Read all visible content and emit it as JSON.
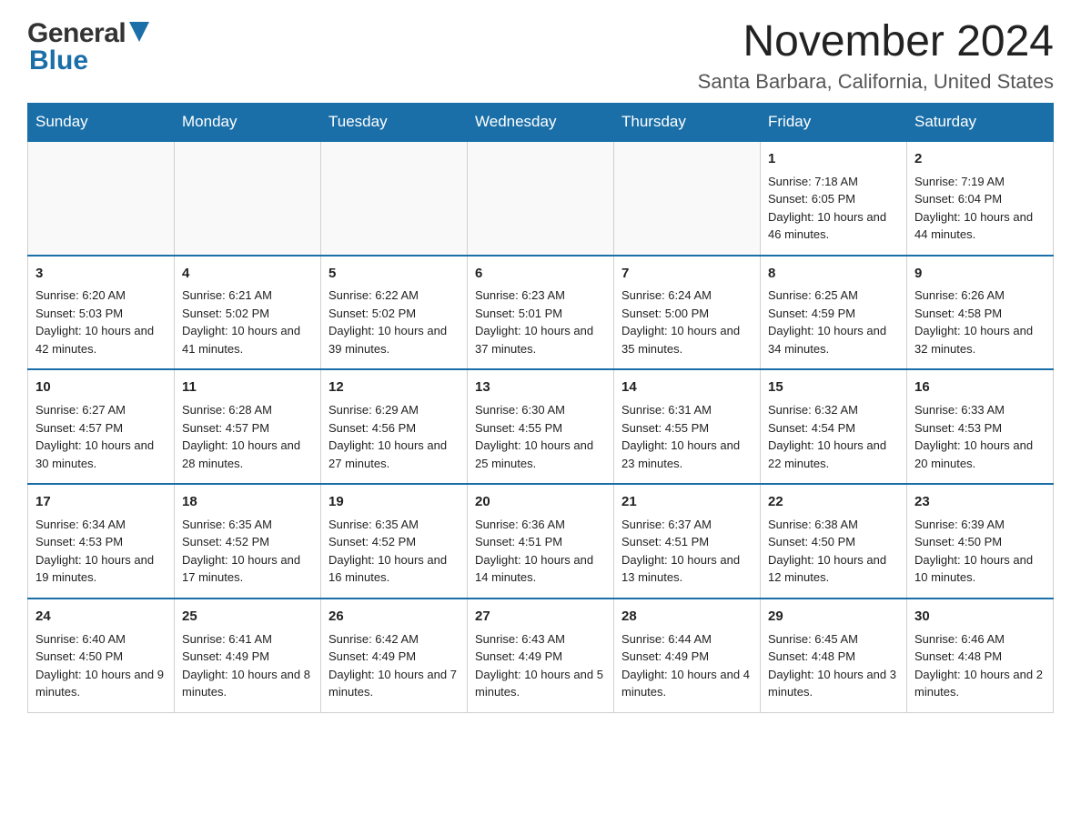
{
  "logo": {
    "general": "General",
    "blue": "Blue",
    "arrow_color": "#1a6fa8"
  },
  "title": "November 2024",
  "subtitle": "Santa Barbara, California, United States",
  "header_color": "#1a6fa8",
  "days_of_week": [
    "Sunday",
    "Monday",
    "Tuesday",
    "Wednesday",
    "Thursday",
    "Friday",
    "Saturday"
  ],
  "weeks": [
    [
      {
        "day": "",
        "info": ""
      },
      {
        "day": "",
        "info": ""
      },
      {
        "day": "",
        "info": ""
      },
      {
        "day": "",
        "info": ""
      },
      {
        "day": "",
        "info": ""
      },
      {
        "day": "1",
        "info": "Sunrise: 7:18 AM\nSunset: 6:05 PM\nDaylight: 10 hours and 46 minutes."
      },
      {
        "day": "2",
        "info": "Sunrise: 7:19 AM\nSunset: 6:04 PM\nDaylight: 10 hours and 44 minutes."
      }
    ],
    [
      {
        "day": "3",
        "info": "Sunrise: 6:20 AM\nSunset: 5:03 PM\nDaylight: 10 hours and 42 minutes."
      },
      {
        "day": "4",
        "info": "Sunrise: 6:21 AM\nSunset: 5:02 PM\nDaylight: 10 hours and 41 minutes."
      },
      {
        "day": "5",
        "info": "Sunrise: 6:22 AM\nSunset: 5:02 PM\nDaylight: 10 hours and 39 minutes."
      },
      {
        "day": "6",
        "info": "Sunrise: 6:23 AM\nSunset: 5:01 PM\nDaylight: 10 hours and 37 minutes."
      },
      {
        "day": "7",
        "info": "Sunrise: 6:24 AM\nSunset: 5:00 PM\nDaylight: 10 hours and 35 minutes."
      },
      {
        "day": "8",
        "info": "Sunrise: 6:25 AM\nSunset: 4:59 PM\nDaylight: 10 hours and 34 minutes."
      },
      {
        "day": "9",
        "info": "Sunrise: 6:26 AM\nSunset: 4:58 PM\nDaylight: 10 hours and 32 minutes."
      }
    ],
    [
      {
        "day": "10",
        "info": "Sunrise: 6:27 AM\nSunset: 4:57 PM\nDaylight: 10 hours and 30 minutes."
      },
      {
        "day": "11",
        "info": "Sunrise: 6:28 AM\nSunset: 4:57 PM\nDaylight: 10 hours and 28 minutes."
      },
      {
        "day": "12",
        "info": "Sunrise: 6:29 AM\nSunset: 4:56 PM\nDaylight: 10 hours and 27 minutes."
      },
      {
        "day": "13",
        "info": "Sunrise: 6:30 AM\nSunset: 4:55 PM\nDaylight: 10 hours and 25 minutes."
      },
      {
        "day": "14",
        "info": "Sunrise: 6:31 AM\nSunset: 4:55 PM\nDaylight: 10 hours and 23 minutes."
      },
      {
        "day": "15",
        "info": "Sunrise: 6:32 AM\nSunset: 4:54 PM\nDaylight: 10 hours and 22 minutes."
      },
      {
        "day": "16",
        "info": "Sunrise: 6:33 AM\nSunset: 4:53 PM\nDaylight: 10 hours and 20 minutes."
      }
    ],
    [
      {
        "day": "17",
        "info": "Sunrise: 6:34 AM\nSunset: 4:53 PM\nDaylight: 10 hours and 19 minutes."
      },
      {
        "day": "18",
        "info": "Sunrise: 6:35 AM\nSunset: 4:52 PM\nDaylight: 10 hours and 17 minutes."
      },
      {
        "day": "19",
        "info": "Sunrise: 6:35 AM\nSunset: 4:52 PM\nDaylight: 10 hours and 16 minutes."
      },
      {
        "day": "20",
        "info": "Sunrise: 6:36 AM\nSunset: 4:51 PM\nDaylight: 10 hours and 14 minutes."
      },
      {
        "day": "21",
        "info": "Sunrise: 6:37 AM\nSunset: 4:51 PM\nDaylight: 10 hours and 13 minutes."
      },
      {
        "day": "22",
        "info": "Sunrise: 6:38 AM\nSunset: 4:50 PM\nDaylight: 10 hours and 12 minutes."
      },
      {
        "day": "23",
        "info": "Sunrise: 6:39 AM\nSunset: 4:50 PM\nDaylight: 10 hours and 10 minutes."
      }
    ],
    [
      {
        "day": "24",
        "info": "Sunrise: 6:40 AM\nSunset: 4:50 PM\nDaylight: 10 hours and 9 minutes."
      },
      {
        "day": "25",
        "info": "Sunrise: 6:41 AM\nSunset: 4:49 PM\nDaylight: 10 hours and 8 minutes."
      },
      {
        "day": "26",
        "info": "Sunrise: 6:42 AM\nSunset: 4:49 PM\nDaylight: 10 hours and 7 minutes."
      },
      {
        "day": "27",
        "info": "Sunrise: 6:43 AM\nSunset: 4:49 PM\nDaylight: 10 hours and 5 minutes."
      },
      {
        "day": "28",
        "info": "Sunrise: 6:44 AM\nSunset: 4:49 PM\nDaylight: 10 hours and 4 minutes."
      },
      {
        "day": "29",
        "info": "Sunrise: 6:45 AM\nSunset: 4:48 PM\nDaylight: 10 hours and 3 minutes."
      },
      {
        "day": "30",
        "info": "Sunrise: 6:46 AM\nSunset: 4:48 PM\nDaylight: 10 hours and 2 minutes."
      }
    ]
  ]
}
